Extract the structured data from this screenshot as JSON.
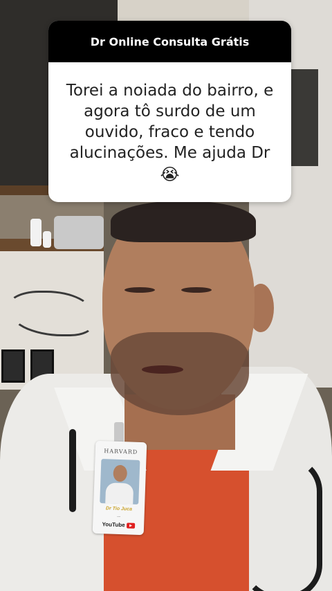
{
  "question_card": {
    "header": "Dr Online Consulta Grátis",
    "question_text": "Torei a noiada do bairro, e agora tô surdo de um ouvido, fraco e tendo alucinações. Me ajuda Dr",
    "emoji": "😭"
  },
  "badge": {
    "institution": "HARVARD",
    "name": "Dr Tio Juca",
    "channel": "YouTube"
  },
  "colors": {
    "header_bg": "#000000",
    "card_bg": "#ffffff",
    "shirt": "#d6502e"
  }
}
